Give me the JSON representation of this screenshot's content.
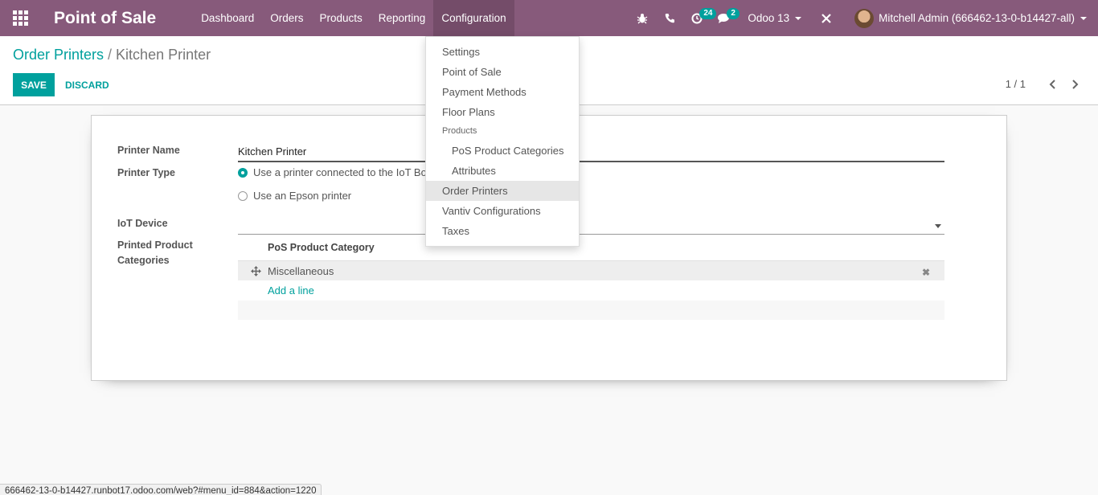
{
  "app": {
    "title": "Point of Sale"
  },
  "nav": {
    "items": [
      {
        "label": "Dashboard"
      },
      {
        "label": "Orders"
      },
      {
        "label": "Products"
      },
      {
        "label": "Reporting"
      },
      {
        "label": "Configuration"
      }
    ]
  },
  "systray": {
    "activity_count": "24",
    "message_count": "2",
    "database": "Odoo 13",
    "user": "Mitchell Admin (666462-13-0-b14427-all)"
  },
  "breadcrumb": {
    "parent": "Order Printers",
    "separator": "/",
    "current": "Kitchen Printer"
  },
  "buttons": {
    "save": "SAVE",
    "discard": "DISCARD"
  },
  "pager": {
    "value": "1 / 1"
  },
  "form": {
    "printer_name_label": "Printer Name",
    "printer_name_value": "Kitchen Printer",
    "printer_type_label": "Printer Type",
    "printer_type_options": [
      {
        "label": "Use a printer connected to the IoT Box",
        "checked": true
      },
      {
        "label": "Use an Epson printer",
        "checked": false
      }
    ],
    "iot_device_label": "IoT Device",
    "iot_device_value": "",
    "categories_label_line1": "Printed Product",
    "categories_label_line2": "Categories",
    "categories_column": "PoS Product Category",
    "categories": [
      "Miscellaneous"
    ],
    "add_line": "Add a line"
  },
  "dropdown": {
    "items": [
      {
        "label": "Settings"
      },
      {
        "label": "Point of Sale"
      },
      {
        "label": "Payment Methods"
      },
      {
        "label": "Floor Plans"
      }
    ],
    "section_header": "Products",
    "sub_items": [
      {
        "label": "PoS Product Categories"
      },
      {
        "label": "Attributes"
      }
    ],
    "items_after": [
      {
        "label": "Order Printers",
        "active": true
      },
      {
        "label": "Vantiv Configurations"
      },
      {
        "label": "Taxes"
      }
    ]
  },
  "statusbar": {
    "url": "666462-13-0-b14427.runbot17.odoo.com/web?#menu_id=884&action=1220"
  },
  "colors": {
    "navbar": "#875a7b",
    "accent": "#00a09d"
  }
}
